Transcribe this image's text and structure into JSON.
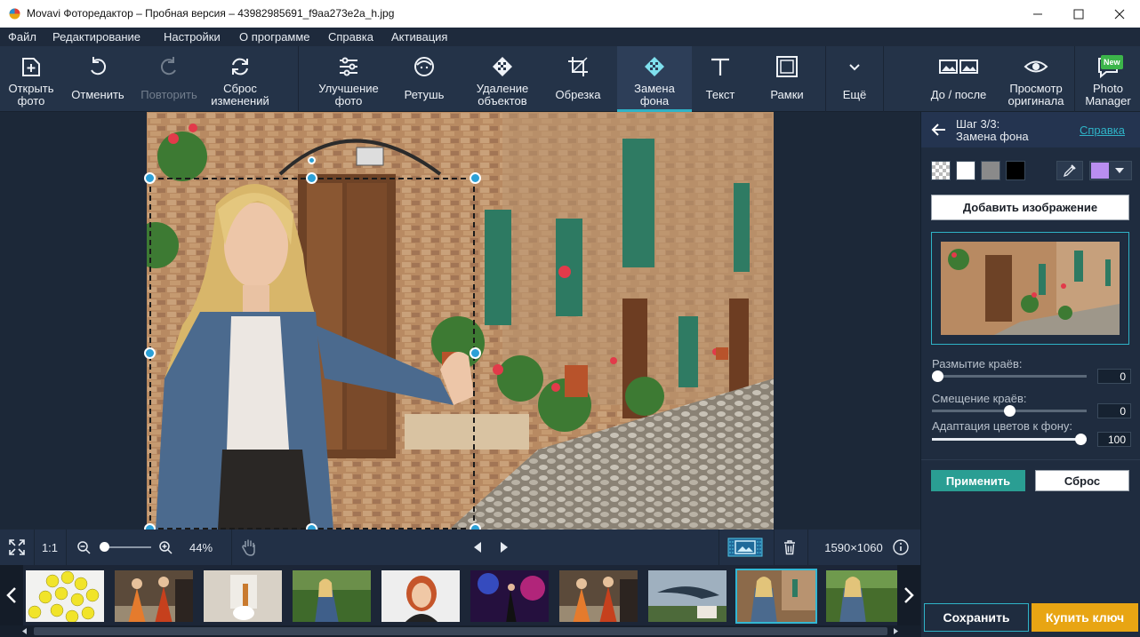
{
  "window": {
    "title": "Movavi Фоторедактор – Пробная версия – 43982985691_f9aa273e2a_h.jpg"
  },
  "menu": [
    "Файл",
    "Редактирование",
    "Настройки",
    "О программе",
    "Справка",
    "Активация"
  ],
  "toolbar": {
    "open": "Открыть\nфото",
    "undo": "Отменить",
    "redo": "Повторить",
    "reset": "Сброс\nизменений",
    "enhance": "Улучшение\nфото",
    "retouch": "Ретушь",
    "remove_objects": "Удаление\nобъектов",
    "crop": "Обрезка",
    "replace_bg": "Замена\nфона",
    "text": "Текст",
    "frames": "Рамки",
    "more": "Ещё",
    "before_after": "До / после",
    "view_original": "Просмотр\nоригинала",
    "photo_manager": "Photo\nManager",
    "new_badge": "New"
  },
  "bottom": {
    "zoom_1_1": "1:1",
    "zoom_percent": "44%",
    "image_size": "1590×1060"
  },
  "panel": {
    "step": "Шаг 3/3:",
    "step_title": "Замена фона",
    "help_link": "Справка",
    "add_image": "Добавить изображение",
    "sliders": [
      {
        "label": "Размытие краёв:",
        "value": "0",
        "fraction": 0.0
      },
      {
        "label": "Смещение краёв:",
        "value": "0",
        "fraction": 0.5
      },
      {
        "label": "Адаптация цветов к фону:",
        "value": "100",
        "fraction": 1.0
      }
    ],
    "apply": "Применить",
    "reset": "Сброс"
  },
  "footer": {
    "save": "Сохранить",
    "buy": "Купить ключ"
  },
  "colors": {
    "accent": "#2fb3c7",
    "apply_bg": "#2a9e93",
    "buy_bg": "#e8a513",
    "swatch_custom": "#b98ef0"
  }
}
